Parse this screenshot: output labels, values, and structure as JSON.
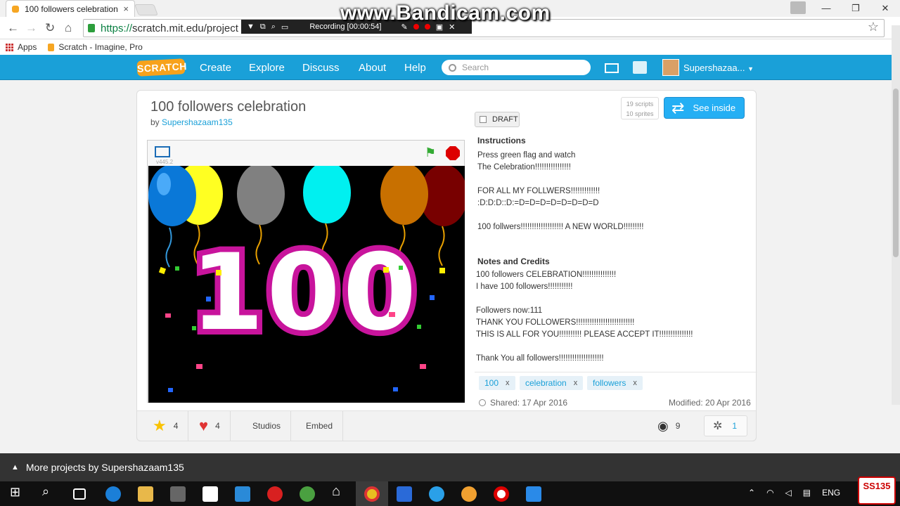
{
  "browser": {
    "tab_title": "100 followers celebration",
    "tab_close": "×",
    "url_scheme": "https://",
    "url_rest": "scratch.mit.edu/project",
    "bookmarks": [
      {
        "label": "Apps"
      },
      {
        "label": "Scratch - Imagine, Pro"
      }
    ]
  },
  "recorder": {
    "status": "Recording [00:00:54]",
    "watermark": "www.Bandicam.com"
  },
  "scratch_nav": {
    "logo": "SCRATCH",
    "links": [
      "Create",
      "Explore",
      "Discuss",
      "About",
      "Help"
    ],
    "search_placeholder": "Search",
    "username": "Supershazaa..."
  },
  "project": {
    "title": "100 followers celebration",
    "by_prefix": "by",
    "author": "Supershazaam135",
    "draft_label": "DRAFT",
    "scripts_count": "19 scripts",
    "sprites_count": "10 sprites",
    "see_inside": "See inside",
    "player_version": "v445.2",
    "instructions_heading": "Instructions",
    "instructions_text": "Press green flag and watch\nThe Celebration!!!!!!!!!!!!!!!!\n\nFOR ALL MY FOLLWERS!!!!!!!!!!!!!\n:D:D:D::D:=D=D=D=D=D=D=D=D\n\n100 follwers!!!!!!!!!!!!!!!!!!! A NEW WORLD!!!!!!!!!",
    "notes_heading": "Notes and Credits",
    "notes_text": "100 followers CELEBRATION!!!!!!!!!!!!!!!\nI have 100 followers!!!!!!!!!!!\n\nFollowers now:111\nTHANK YOU FOLLOWERS!!!!!!!!!!!!!!!!!!!!!!!!!!\nTHIS IS ALL FOR YOU!!!!!!!!!! PLEASE ACCEPT IT!!!!!!!!!!!!!!!\n\nThank You all followers!!!!!!!!!!!!!!!!!!!!",
    "tags": [
      "100",
      "celebration",
      "followers"
    ],
    "tag_remove": "x",
    "shared": "Shared: 17 Apr 2016",
    "modified": "Modified: 20 Apr 2016",
    "stage_text": "100"
  },
  "stats": {
    "favorites": "4",
    "loves": "4",
    "studios": "Studios",
    "embed": "Embed",
    "views": "9",
    "remixes": "1"
  },
  "more_projects": "More projects by Supershazaam135",
  "taskbar": {
    "language": "ENG",
    "badge": "SS135"
  },
  "colors": {
    "scratch_blue": "#1aa0d8",
    "balloon_blue": "#0a78d8",
    "balloon_yellow": "#ffff22",
    "balloon_gray": "#808080",
    "balloon_cyan": "#00f0f0",
    "balloon_orange": "#c87000",
    "balloon_maroon": "#780000",
    "digit_magenta": "#c8149c"
  }
}
